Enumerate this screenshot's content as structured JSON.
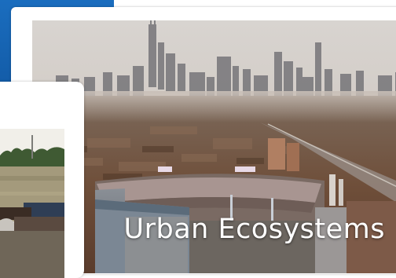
{
  "caption": {
    "text": "Urban Ecosystems"
  },
  "colors": {
    "accent_blue": "#1b6fc1",
    "sky_top": "#d9d6d3",
    "skyline": "#6e6e74",
    "caption_text": "#ffffff"
  }
}
